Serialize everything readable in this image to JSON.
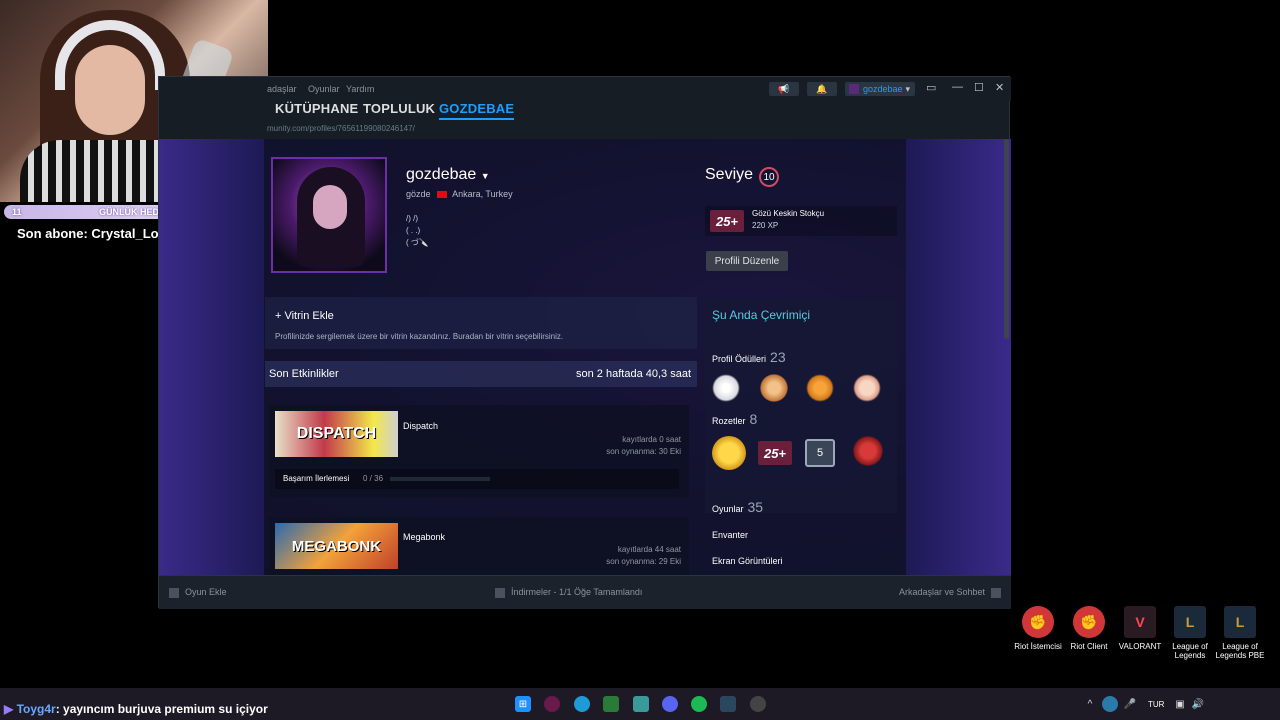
{
  "stream": {
    "goal_left": "11",
    "goal_label": "GÜNLÜK HEDEF",
    "goal_right": "10",
    "last_sub": "Son abone: Crystal_LoL",
    "chat_user": "Toyg4r",
    "chat_message": ": yayıncım burjuva premium su içiyor"
  },
  "steam": {
    "menu": [
      "adaşlar",
      "Oyunlar",
      "Yardım"
    ],
    "nav": [
      "KÜTÜPHANE",
      "TOPLULUK",
      "GOZDEBAE"
    ],
    "url": "munity.com/profiles/76561199080246147/",
    "account_name": "gozdebae",
    "profile": {
      "username": "gozdebae",
      "real_name": "gözde",
      "location": "Ankara, Turkey",
      "summary_lines": [
        "/) /)",
        "( . .)",
        "( づ🔪"
      ],
      "level_label": "Seviye",
      "level": "10",
      "badge_icon_text": "25+",
      "badge_name": "Gözü Keskin Stokçu",
      "badge_xp": "220 XP",
      "edit_button": "Profili Düzenle"
    },
    "showcase": {
      "title": "+ Vitrin Ekle",
      "description": "Profilinizde sergilemek üzere bir vitrin kazandınız. Buradan bir vitrin seçebilirsiniz."
    },
    "activity": {
      "title": "Son Etkinlikler",
      "hours": "son 2 haftada 40,3 saat",
      "games": [
        {
          "name": "Dispatch",
          "cover_text": "DISPATCH",
          "recorded": "kayıtlarda 0 saat",
          "last_played": "son oynanma: 30 Eki",
          "achievements_label": "Başarım İlerlemesi",
          "achievements": "0 / 36",
          "achievement_progress": 0
        },
        {
          "name": "Megabonk",
          "cover_text": "MEGABONK",
          "recorded": "kayıtlarda 44 saat",
          "last_played": "son oynanma: 29 Eki"
        }
      ]
    },
    "sidebar": {
      "status": "Şu Anda Çevrimiçi",
      "awards_label": "Profil Ödülleri",
      "awards_count": "23",
      "badges_label": "Rozetler",
      "badges_count": "8",
      "badge_five": "5",
      "games_label": "Oyunlar",
      "games_count": "35",
      "inventory": "Envanter",
      "screenshots": "Ekran Görüntüleri"
    },
    "statusbar": {
      "add_game": "Oyun Ekle",
      "downloads": "İndirmeler - 1/1 Öğe Tamamlandı",
      "friends": "Arkadaşlar ve Sohbet"
    }
  },
  "desktop_icons": [
    {
      "label": "Riot İstemcisi",
      "color": "#d13639"
    },
    {
      "label": "Riot Client",
      "color": "#d13639"
    },
    {
      "label": "VALORANT",
      "color": "#ff4655"
    },
    {
      "label": "League of Legends",
      "color": "#c89b3c"
    },
    {
      "label": "League of Legends PBE",
      "color": "#c89b3c"
    }
  ],
  "taskbar": {
    "language": "TUR"
  },
  "colors": {
    "steam_blue": "#1a9fff",
    "level_ring": "#d24b63",
    "steam_bg": "#171d25"
  }
}
